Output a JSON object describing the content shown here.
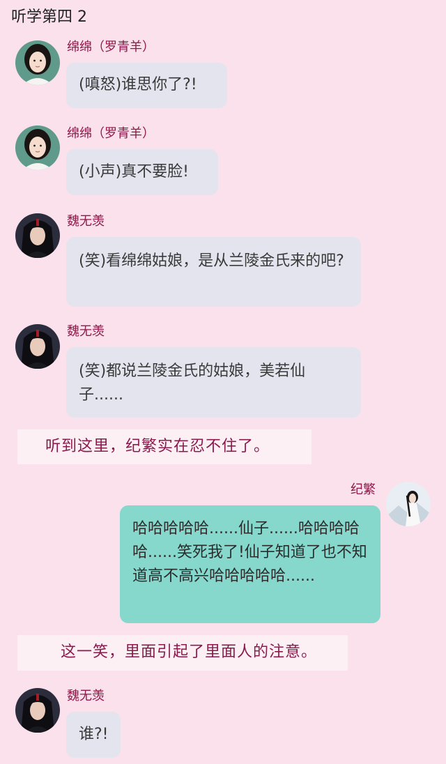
{
  "header": {
    "title": "听学第四 2"
  },
  "messages": [
    {
      "speaker": "绵绵（罗青羊）",
      "text": "(嗔怒)谁思你了?!",
      "avatar": "female-avatar-icon"
    },
    {
      "speaker": "绵绵（罗青羊）",
      "text": "(小声)真不要脸!",
      "avatar": "female-avatar-icon"
    },
    {
      "speaker": "魏无羡",
      "text": "(笑)看绵绵姑娘，是从兰陵金氏来的吧?",
      "avatar": "male-avatar-icon"
    },
    {
      "speaker": "魏无羡",
      "text": "(笑)都说兰陵金氏的姑娘，美若仙子......",
      "avatar": "male-avatar-icon"
    },
    {
      "narration": "听到这里，纪繁实在忍不住了。"
    },
    {
      "speaker": "纪繁",
      "text": "哈哈哈哈哈......仙子......哈哈哈哈哈......笑死我了!仙子知道了也不知道高不高兴哈哈哈哈哈......",
      "avatar": "self-avatar-icon"
    },
    {
      "narration": "这一笑，里面引起了里面人的注意。"
    },
    {
      "speaker": "魏无羡",
      "text": "谁?!",
      "avatar": "male-avatar-icon"
    }
  ],
  "colors": {
    "background": "#fbe1ec",
    "name": "#8f1848",
    "bubble": "#e3e4ed",
    "bubble_self": "#86d8cd",
    "narration_bg": "#fdf0f5",
    "narration_text": "#8a1a4c"
  }
}
